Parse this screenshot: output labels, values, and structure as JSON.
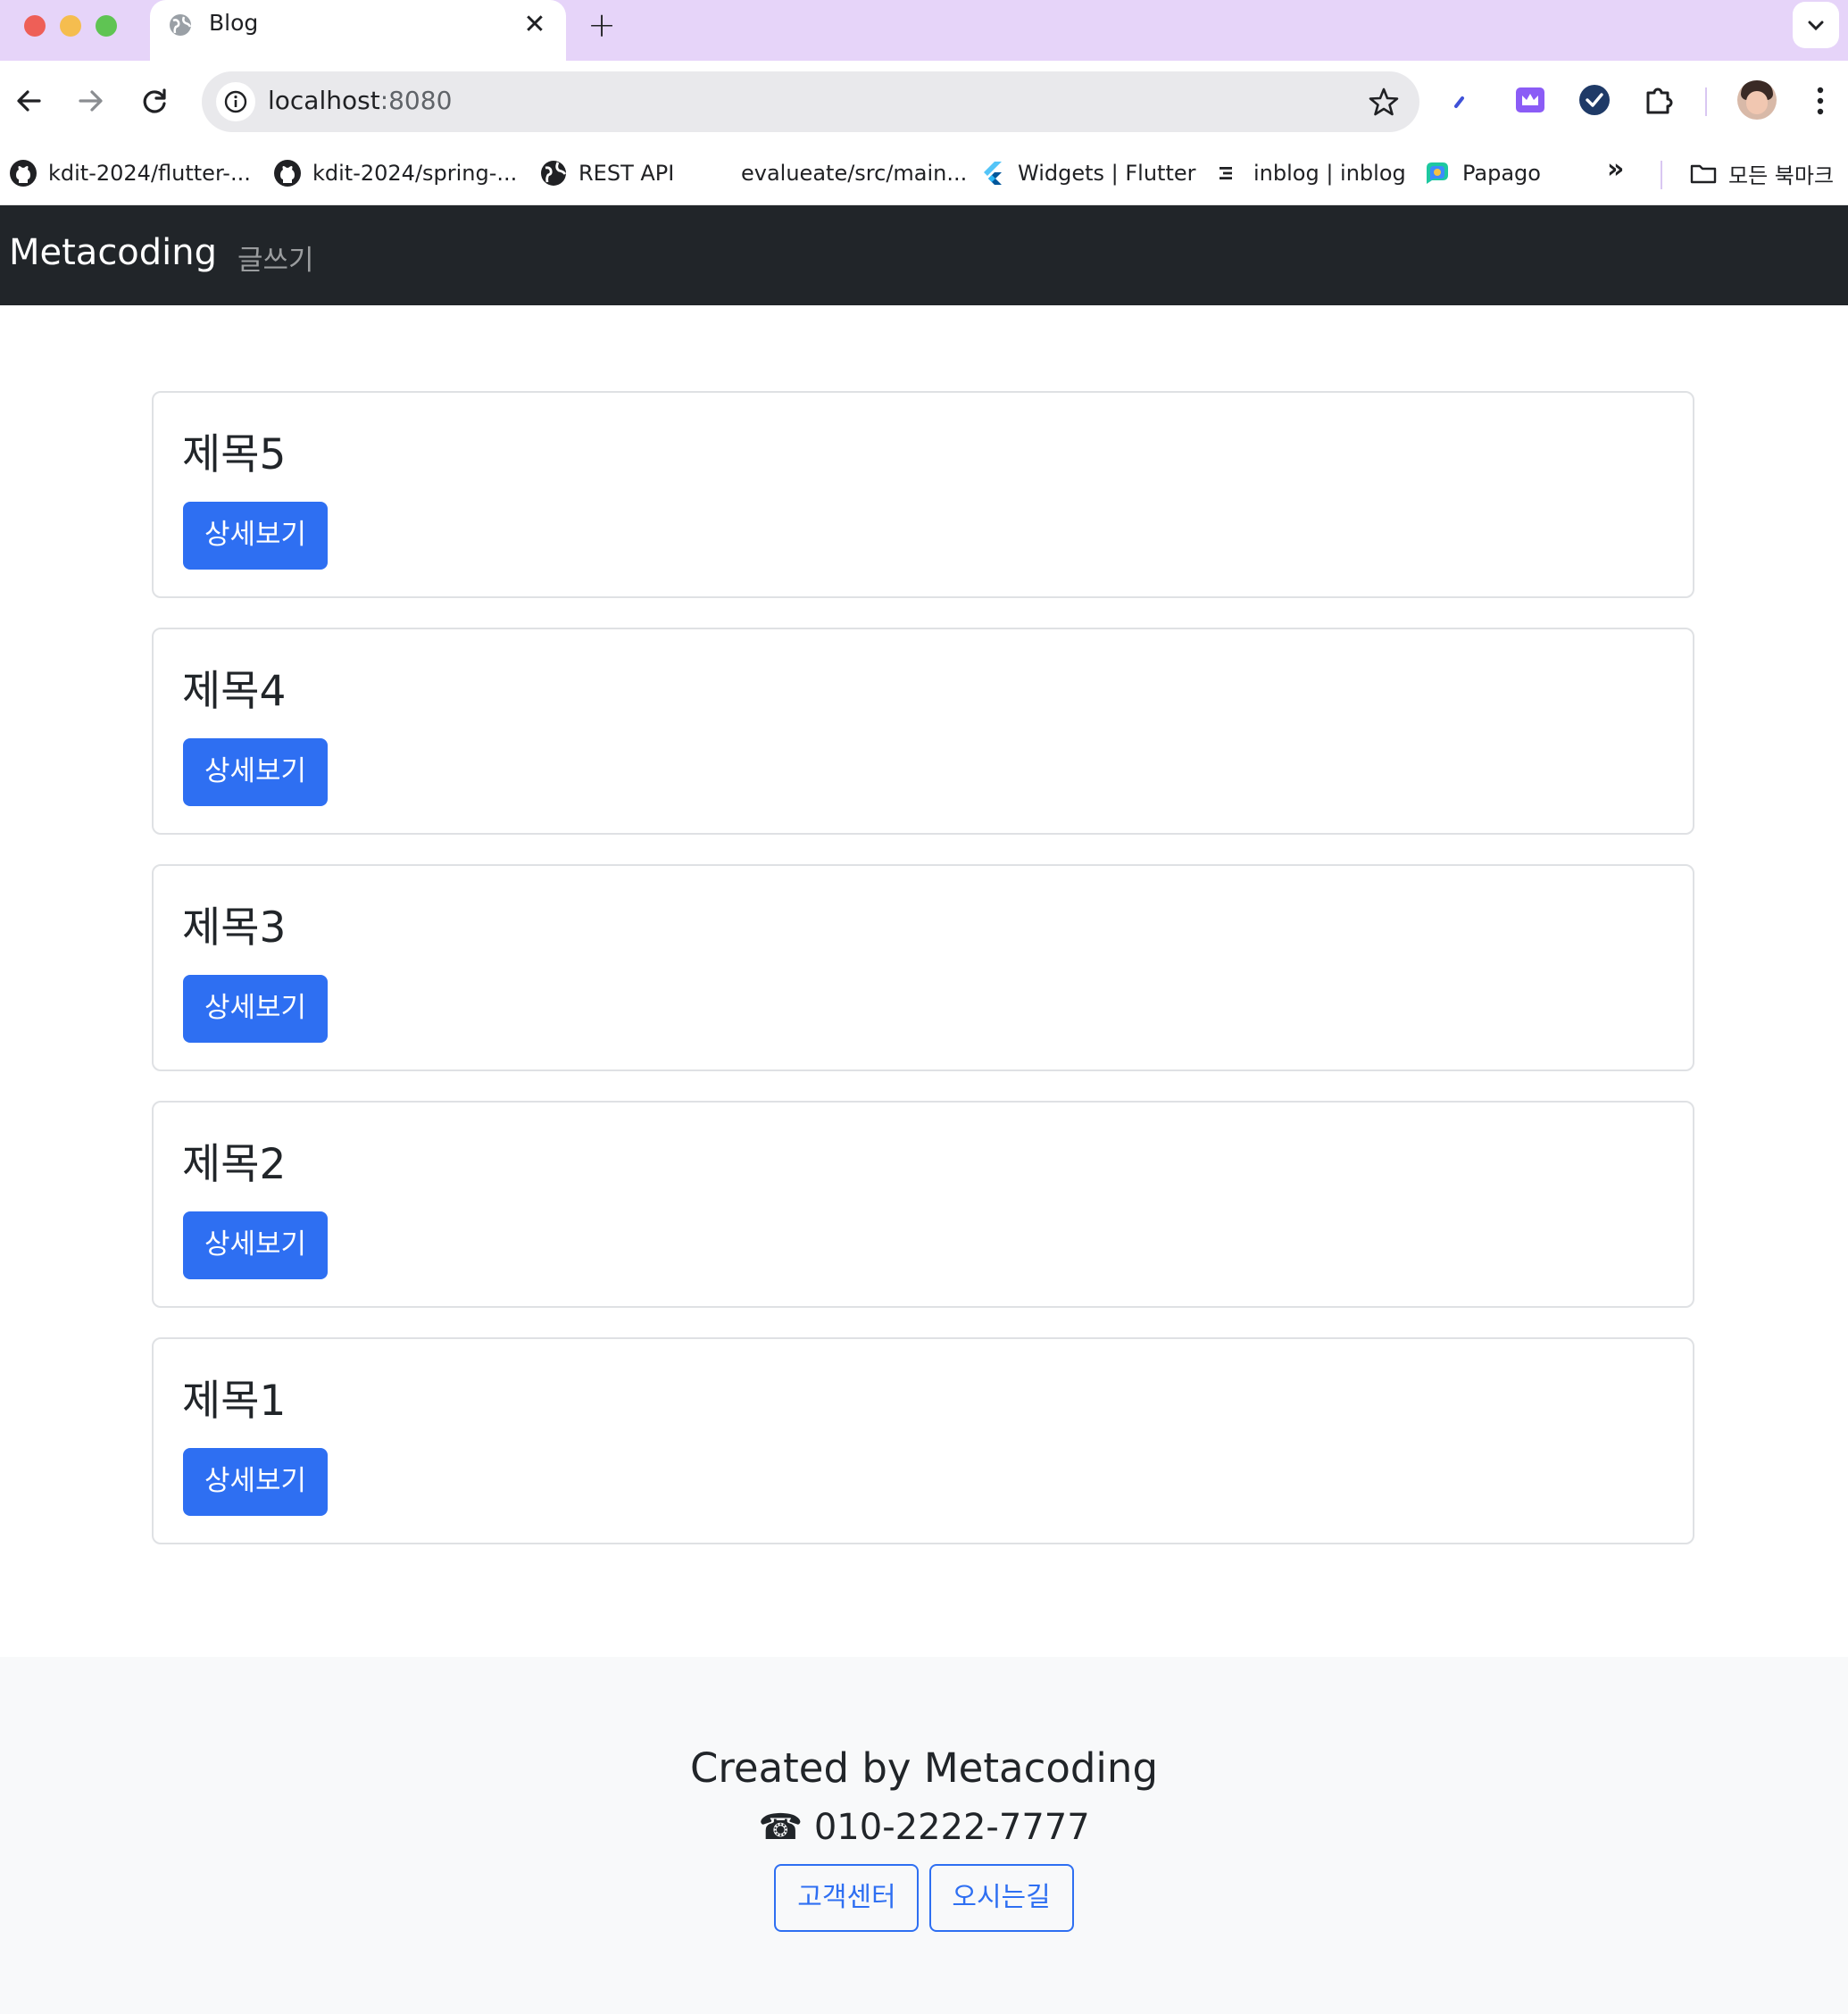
{
  "browser": {
    "tab_title": "Blog",
    "tab_close": "✕",
    "new_tab": "+",
    "url_host": "localhost",
    "url_port": ":8080",
    "bookmarks": [
      {
        "label": "kdit-2024/flutter-...",
        "icon": "github-icon"
      },
      {
        "label": "kdit-2024/spring-...",
        "icon": "github-icon"
      },
      {
        "label": "REST API",
        "icon": "globe-icon"
      },
      {
        "label": "evalueate/src/main...",
        "icon": "none"
      },
      {
        "label": "Widgets | Flutter",
        "icon": "flutter-icon"
      },
      {
        "label": "inblog | inblog",
        "icon": "inblog-icon"
      },
      {
        "label": "Papago",
        "icon": "papago-icon"
      }
    ],
    "bookmarks_more": "»",
    "all_bookmarks": "모든 북마크"
  },
  "site": {
    "brand": "Metacoding",
    "nav_write": "글쓰기",
    "posts": [
      {
        "title": "제목5",
        "button": "상세보기"
      },
      {
        "title": "제목4",
        "button": "상세보기"
      },
      {
        "title": "제목3",
        "button": "상세보기"
      },
      {
        "title": "제목2",
        "button": "상세보기"
      },
      {
        "title": "제목1",
        "button": "상세보기"
      }
    ],
    "footer": {
      "title": "Created by Metacoding",
      "phone": "☎ 010-2222-7777",
      "buttons": [
        "고객센터",
        "오시는길"
      ]
    }
  },
  "colors": {
    "primary": "#2e6ff2",
    "navbar": "#212529",
    "tabstrip": "#e6d4f9",
    "footer_bg": "#f8f9fa"
  }
}
